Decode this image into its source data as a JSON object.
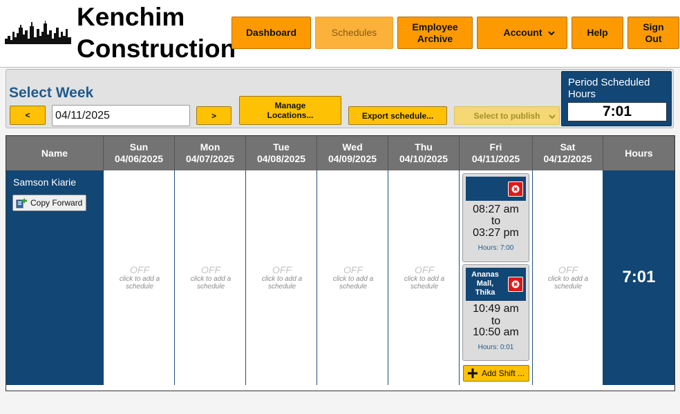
{
  "brand": {
    "name": "Kenchim Construction"
  },
  "nav": {
    "dashboard": "Dashboard",
    "schedules": "Schedules",
    "employee_archive": "Employee Archive",
    "account": "Account",
    "help": "Help",
    "sign_out": "Sign Out"
  },
  "week": {
    "title": "Select Week",
    "prev": "<",
    "next": ">",
    "date": "04/11/2025",
    "manage_locations": "Manage Locations...",
    "export": "Export schedule...",
    "publish": "Select to publish"
  },
  "period": {
    "label": "Period Scheduled Hours",
    "value": "7:01"
  },
  "table": {
    "headers": {
      "name": "Name",
      "hours": "Hours",
      "days": [
        {
          "day": "Sun",
          "date": "04/06/2025"
        },
        {
          "day": "Mon",
          "date": "04/07/2025"
        },
        {
          "day": "Tue",
          "date": "04/08/2025"
        },
        {
          "day": "Wed",
          "date": "04/09/2025"
        },
        {
          "day": "Thu",
          "date": "04/10/2025"
        },
        {
          "day": "Fri",
          "date": "04/11/2025"
        },
        {
          "day": "Sat",
          "date": "04/12/2025"
        }
      ]
    },
    "employee": {
      "name": "Samson Kiarie",
      "copy_forward": "Copy Forward",
      "total_hours": "7:01"
    },
    "off_label": "OFF",
    "off_hint": "click to add a schedule",
    "shifts": [
      {
        "location": "",
        "start": "08:27 am",
        "to": "to",
        "end": "03:27 pm",
        "hours": "Hours: 7:00"
      },
      {
        "location": "Ananas Mall, Thika",
        "start": "10:49 am",
        "to": "to",
        "end": "10:50 am",
        "hours": "Hours: 0:01"
      }
    ],
    "add_shift": "Add Shift ..."
  },
  "colors": {
    "nav_orange": "#fd9a02",
    "navy": "#114675",
    "yellow": "#fec104",
    "header_gray": "#737373",
    "delete_red": "#e01818"
  }
}
